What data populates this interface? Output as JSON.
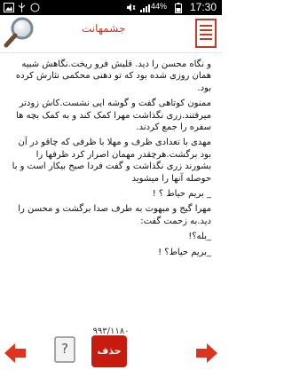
{
  "status_bar": {
    "time": "17:30",
    "battery": "44%"
  },
  "header": {
    "title": "جشمهانت",
    "search_icon": "search-icon",
    "menu_icon": "menu-icon"
  },
  "content": {
    "paragraphs": [
      "و نگاه محسن را دید. قلبش فرو ریخت.نگاهش شبیه همان روزی شده بود که تو دهنی محکمی نثارش کرده بود.",
      "ممنون کوتاهی گفت و گوشه ایی نشست.کاش زودتر میرفتند.زری نگذاشت مهرا کمک کند و به کمک بچه ها سفره را جمع کردند.",
      "مهدی با تعدادی ظرف و مهلا با ظرفی که چاقو در آن بود برگشت.هرچقدر مهمان اصرار کرد ظرفها را بشورند زری نگذاشت و گفت فردا صبح بیکار است و با حوصله آنها را میشوید",
      "_ بریم حیاط ؟ !",
      "مهرا گیج و مبهوت به طرف صدا برگشت و محسن را دید.به زحمت گفت:",
      "_بله؟!",
      "_بریم حیاط؟ !"
    ]
  },
  "footer": {
    "counter": "۹۹۳/۱۱۸۰",
    "delete_label": "حذف",
    "help_label": "?"
  },
  "colors": {
    "accent": "#c81b0f",
    "title": "#c23b22"
  }
}
